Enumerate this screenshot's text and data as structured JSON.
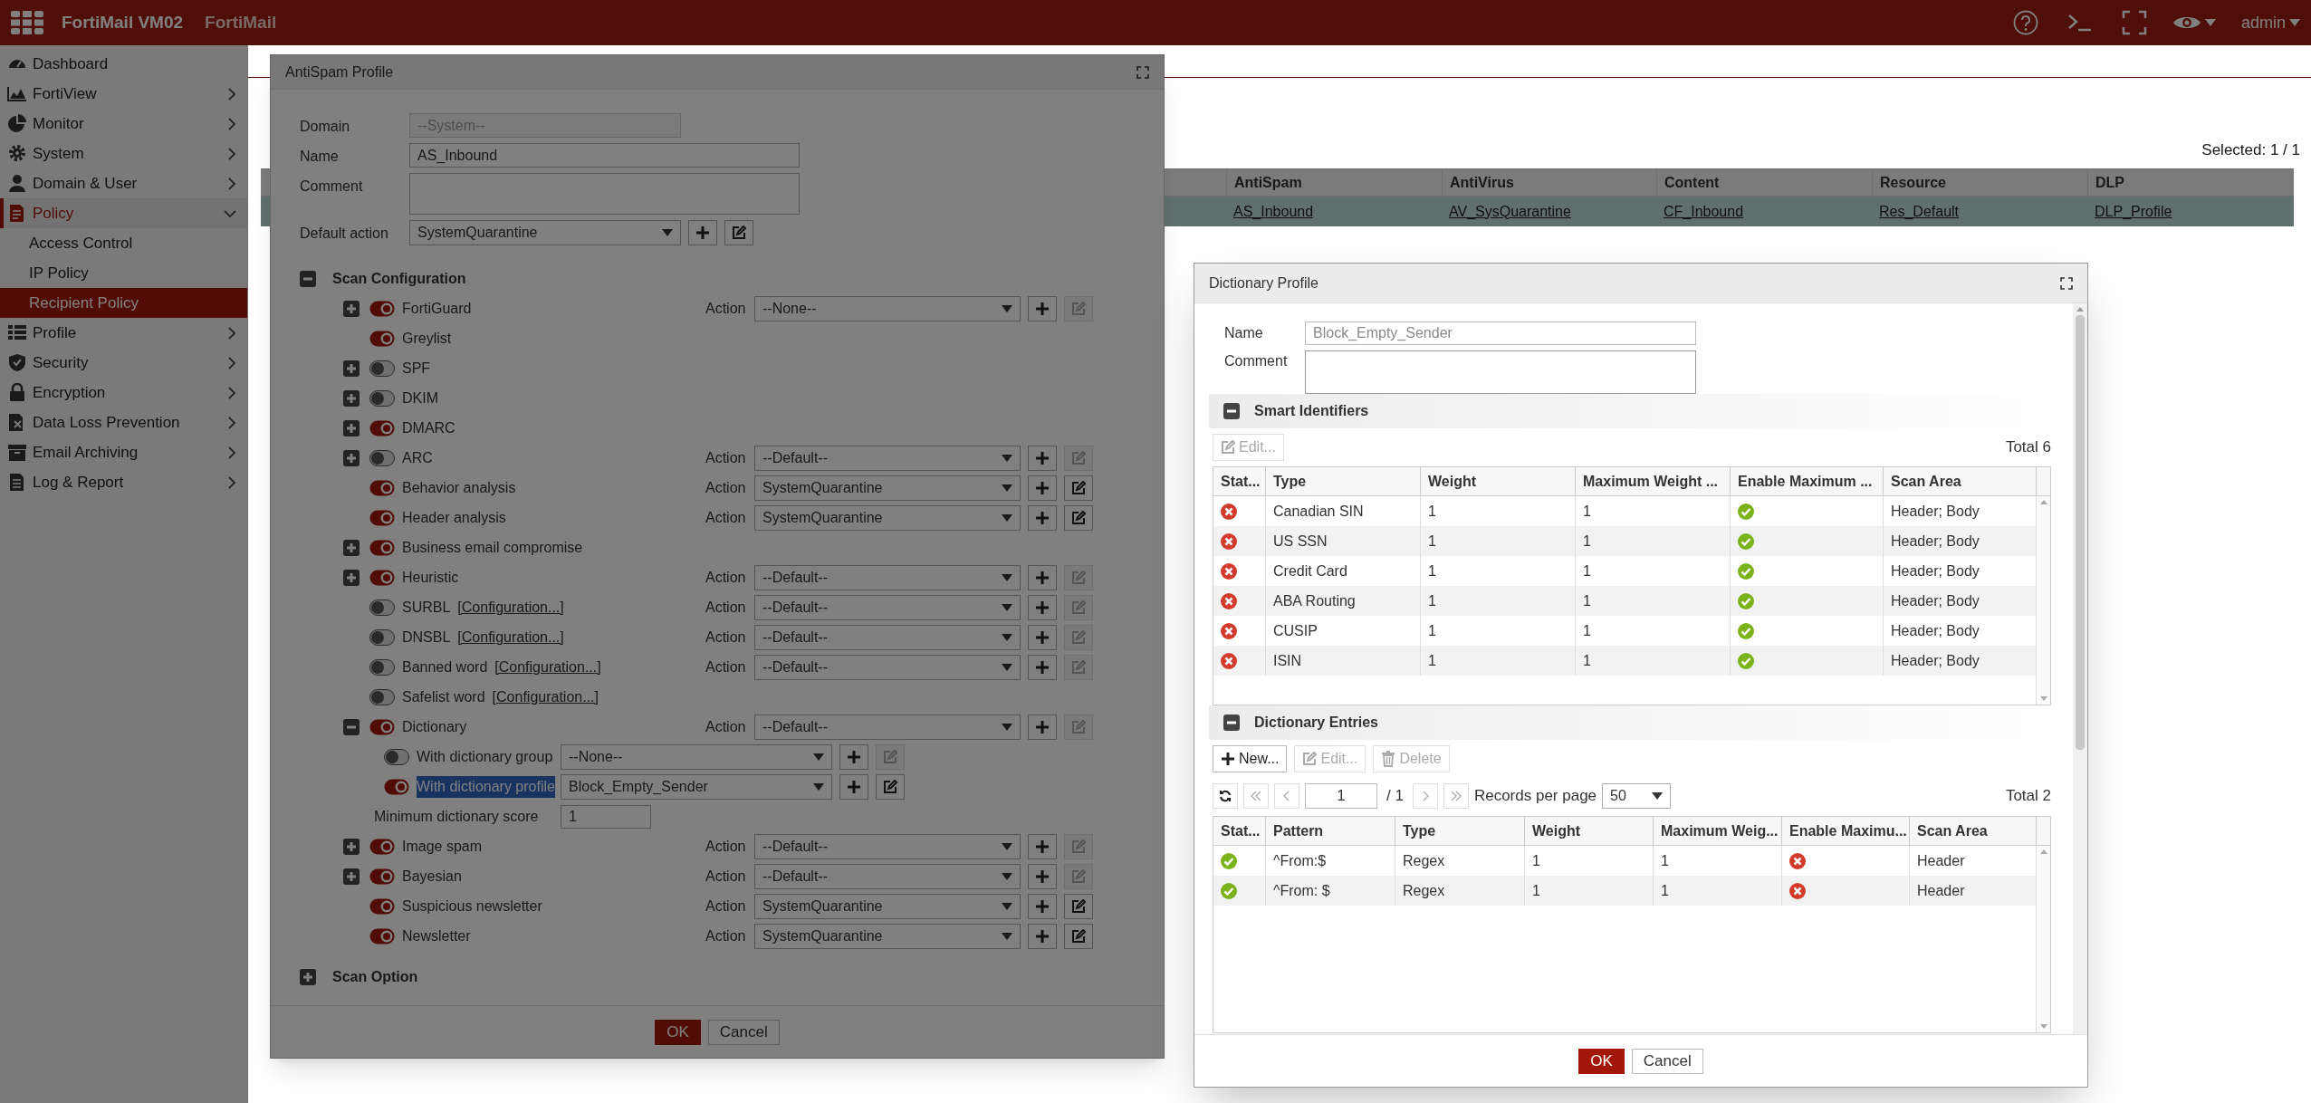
{
  "top_bar": {
    "product": "FortiMail VM02",
    "product_name": "FortiMail",
    "user": "admin"
  },
  "sidebar": {
    "items": [
      {
        "label": "Dashboard",
        "selected": false
      },
      {
        "label": "FortiView",
        "selected": false,
        "expanded": false
      },
      {
        "label": "Monitor",
        "selected": false,
        "expanded": false
      },
      {
        "label": "System",
        "selected": false,
        "expanded": false
      },
      {
        "label": "Domain & User",
        "selected": false,
        "expanded": false
      },
      {
        "label": "Policy",
        "selected": false,
        "expanded": true,
        "children": [
          {
            "label": "Access Control",
            "selected": false
          },
          {
            "label": "IP Policy",
            "selected": false
          },
          {
            "label": "Recipient Policy",
            "selected": true
          }
        ]
      },
      {
        "label": "Profile",
        "selected": false,
        "expanded": false
      },
      {
        "label": "Security",
        "selected": false,
        "expanded": false
      },
      {
        "label": "Encryption",
        "selected": false,
        "expanded": false
      },
      {
        "label": "Data Loss Prevention",
        "selected": false,
        "expanded": false
      },
      {
        "label": "Email Archiving",
        "selected": false,
        "expanded": false
      },
      {
        "label": "Log & Report",
        "selected": false,
        "expanded": false
      }
    ]
  },
  "policy_table": {
    "selected_count": "Selected: 1 / 1",
    "columns": [
      "AntiSpam",
      "AntiVirus",
      "Content",
      "Resource",
      "DLP"
    ],
    "rows": [
      {
        "selected": true,
        "cells": [
          "AS_Inbound",
          "AV_SysQuarantine",
          "CF_Inbound",
          "Res_Default",
          "DLP_Profile"
        ]
      }
    ]
  },
  "antispam_dialog": {
    "title": "AntiSpam Profile",
    "fields": [
      {
        "kind": "readonly",
        "label": "Domain",
        "value": "--System--"
      },
      {
        "kind": "text",
        "label": "Name",
        "value": "AS_Inbound"
      },
      {
        "kind": "textarea",
        "label": "Comment"
      },
      {
        "kind": "select",
        "label": "Default action",
        "value": "SystemQuarantine",
        "edit_enabled": true
      }
    ],
    "scan_configuration": {
      "title": "Scan Configuration",
      "expanded": true,
      "items": [
        {
          "label": "FortiGuard",
          "expandable": true,
          "on": true,
          "action": {
            "label": "Action",
            "value": "--None--",
            "edit_enabled": false
          }
        },
        {
          "label": "Greylist",
          "expandable": false,
          "on": true
        },
        {
          "label": "SPF",
          "expandable": true,
          "on": false
        },
        {
          "label": "DKIM",
          "expandable": true,
          "on": false
        },
        {
          "label": "DMARC",
          "expandable": true,
          "on": true
        },
        {
          "label": "ARC",
          "expandable": true,
          "on": false,
          "action": {
            "label": "Action",
            "value": "--Default--",
            "edit_enabled": false
          }
        },
        {
          "label": "Behavior analysis",
          "expandable": false,
          "on": true,
          "action": {
            "label": "Action",
            "value": "SystemQuarantine",
            "edit_enabled": true
          }
        },
        {
          "label": "Header analysis",
          "expandable": false,
          "on": true,
          "action": {
            "label": "Action",
            "value": "SystemQuarantine",
            "edit_enabled": true
          }
        },
        {
          "label": "Business email compromise",
          "expandable": true,
          "on": true
        },
        {
          "label": "Heuristic",
          "expandable": true,
          "on": true,
          "action": {
            "label": "Action",
            "value": "--Default--",
            "edit_enabled": false
          }
        },
        {
          "label": "SURBL",
          "link": "[Configuration...]",
          "expandable": false,
          "on": false,
          "action": {
            "label": "Action",
            "value": "--Default--",
            "edit_enabled": false
          }
        },
        {
          "label": "DNSBL",
          "link": "[Configuration...]",
          "expandable": false,
          "on": false,
          "action": {
            "label": "Action",
            "value": "--Default--",
            "edit_enabled": false
          }
        },
        {
          "label": "Banned word",
          "link": "[Configuration...]",
          "expandable": false,
          "on": false,
          "action": {
            "label": "Action",
            "value": "--Default--",
            "edit_enabled": false
          }
        },
        {
          "label": "Safelist word",
          "link": "[Configuration...]",
          "expandable": false,
          "on": false
        },
        {
          "label": "Dictionary",
          "expandable": true,
          "expanded": true,
          "on": true,
          "action": {
            "label": "Action",
            "value": "--Default--",
            "edit_enabled": false
          },
          "children": [
            {
              "kind": "toggle",
              "label": "With dictionary group",
              "on": false,
              "highlighted": false,
              "value": "--None--",
              "edit_enabled": false
            },
            {
              "kind": "toggle",
              "label": "With dictionary profile",
              "on": true,
              "highlighted": true,
              "value": "Block_Empty_Sender",
              "edit_enabled": true
            },
            {
              "kind": "number",
              "label": "Minimum dictionary score",
              "value": "1"
            }
          ]
        },
        {
          "label": "Image spam",
          "expandable": true,
          "on": true,
          "action": {
            "label": "Action",
            "value": "--Default--",
            "edit_enabled": false
          }
        },
        {
          "label": "Bayesian",
          "expandable": true,
          "on": true,
          "action": {
            "label": "Action",
            "value": "--Default--",
            "edit_enabled": false
          }
        },
        {
          "label": "Suspicious newsletter",
          "expandable": false,
          "on": true,
          "action": {
            "label": "Action",
            "value": "SystemQuarantine",
            "edit_enabled": true
          }
        },
        {
          "label": "Newsletter",
          "expandable": false,
          "on": true,
          "action": {
            "label": "Action",
            "value": "SystemQuarantine",
            "edit_enabled": true
          }
        }
      ]
    },
    "scan_option": {
      "title": "Scan Option",
      "expanded": false
    },
    "buttons": [
      {
        "label": "OK",
        "primary": true
      },
      {
        "label": "Cancel",
        "primary": false
      }
    ]
  },
  "dictionary_dialog": {
    "title": "Dictionary Profile",
    "name": {
      "label": "Name",
      "value": "Block_Empty_Sender"
    },
    "comment": {
      "label": "Comment"
    },
    "smart_identifiers": {
      "title": "Smart Identifiers",
      "expanded": true,
      "toolbar": [
        {
          "kind": "edit",
          "label": "Edit...",
          "disabled": true
        }
      ],
      "total": "Total 6",
      "columns": [
        "Stat...",
        "Type",
        "Weight",
        "Maximum Weight ...",
        "Enable Maximum ...",
        "Scan Area"
      ],
      "rows": [
        {
          "status_ok": false,
          "type": "Canadian SIN",
          "weight": "1",
          "max_weight": "1",
          "enable_max": true,
          "scan_area": "Header; Body"
        },
        {
          "status_ok": false,
          "type": "US SSN",
          "weight": "1",
          "max_weight": "1",
          "enable_max": true,
          "scan_area": "Header; Body"
        },
        {
          "status_ok": false,
          "type": "Credit Card",
          "weight": "1",
          "max_weight": "1",
          "enable_max": true,
          "scan_area": "Header; Body"
        },
        {
          "status_ok": false,
          "type": "ABA Routing",
          "weight": "1",
          "max_weight": "1",
          "enable_max": true,
          "scan_area": "Header; Body"
        },
        {
          "status_ok": false,
          "type": "CUSIP",
          "weight": "1",
          "max_weight": "1",
          "enable_max": true,
          "scan_area": "Header; Body"
        },
        {
          "status_ok": false,
          "type": "ISIN",
          "weight": "1",
          "max_weight": "1",
          "enable_max": true,
          "scan_area": "Header; Body"
        }
      ]
    },
    "dictionary_entries": {
      "title": "Dictionary Entries",
      "expanded": true,
      "toolbar": [
        {
          "kind": "new",
          "label": "New...",
          "disabled": false
        },
        {
          "kind": "edit",
          "label": "Edit...",
          "disabled": true
        },
        {
          "kind": "delete",
          "label": "Delete",
          "disabled": true
        }
      ],
      "pager": {
        "page": "1",
        "of": "/ 1",
        "records_label": "Records per page",
        "per_page": "50"
      },
      "total": "Total 2",
      "columns": [
        "Stat...",
        "Pattern",
        "Type",
        "Weight",
        "Maximum Weig...",
        "Enable Maximu...",
        "Scan Area"
      ],
      "rows": [
        {
          "status_ok": true,
          "pattern": "^From:$",
          "type": "Regex",
          "weight": "1",
          "max_weight": "1",
          "enable_max": false,
          "scan_area": "Header"
        },
        {
          "status_ok": true,
          "pattern": "^From: $",
          "type": "Regex",
          "weight": "1",
          "max_weight": "1",
          "enable_max": false,
          "scan_area": "Header"
        }
      ]
    },
    "buttons": [
      {
        "label": "OK",
        "primary": true
      },
      {
        "label": "Cancel",
        "primary": false
      }
    ]
  }
}
